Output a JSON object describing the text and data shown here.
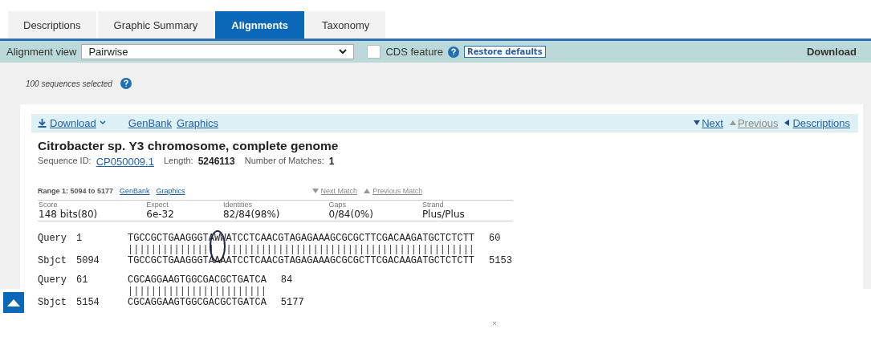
{
  "tabs": [
    {
      "label": "Descriptions",
      "selected": false
    },
    {
      "label": "Graphic Summary",
      "selected": false
    },
    {
      "label": "Alignments",
      "selected": true
    },
    {
      "label": "Taxonomy",
      "selected": false
    }
  ],
  "toolbar": {
    "view_label": "Alignment view",
    "view_value": "Pairwise",
    "cds_label": "CDS feature",
    "cds_checked": false,
    "restore_button": "Restore defaults",
    "download": "Download"
  },
  "selection_note": "100 sequences selected",
  "result": {
    "header_links": [
      {
        "label": "Download",
        "kind": "download"
      },
      {
        "label": "GenBank",
        "kind": "link"
      },
      {
        "label": "Graphics",
        "kind": "link"
      }
    ],
    "nav": [
      {
        "label": "Next",
        "kind": "down",
        "disabled": false
      },
      {
        "label": "Previous",
        "kind": "up",
        "disabled": true
      },
      {
        "label": "Descriptions",
        "kind": "left",
        "disabled": false
      }
    ],
    "title": "Citrobacter sp. Y3 chromosome, complete genome",
    "sequence_id_label": "Sequence ID:",
    "sequence_id": "CP050009.1",
    "length_label": "Length:",
    "length": "5246113",
    "matches_label": "Number of Matches:",
    "matches": "1",
    "range": {
      "label": "Range 1: 5094 to 5177",
      "links": [
        "GenBank",
        "Graphics"
      ],
      "match_nav": [
        {
          "label": "Next Match",
          "kind": "down",
          "disabled": true
        },
        {
          "label": "Previous Match",
          "kind": "up",
          "disabled": true
        }
      ]
    },
    "stats": {
      "columns": [
        "Score",
        "Expect",
        "Identities",
        "Gaps",
        "Strand"
      ],
      "values": [
        "148 bits(80)",
        "6e-32",
        "82/84(98%)",
        "0/84(0%)",
        "Plus/Plus"
      ]
    },
    "alignment": [
      {
        "annotated": true,
        "query_label": "Query",
        "query_start": "1",
        "query_seq": "TGCCGCTGAAGGGTAWWATCCTCAACGTAGAGAAAGCGCGCTTCGACAAGATGCTCTCTT",
        "query_end": "60",
        "match": "|||||||||||||||  |||||||||||||||||||||||||||||||||||||||||||",
        "sbjct_label": "Sbjct",
        "sbjct_start": "5094",
        "sbjct_seq": "TGCCGCTGAAGGGTAAAATCCTCAACGTAGAGAAAGCGCGCTTCGACAAGATGCTCTCTT",
        "sbjct_end": "5153"
      },
      {
        "annotated": false,
        "query_label": "Query",
        "query_start": "61",
        "query_seq": "CGCAGGAAGTGGCGACGCTGATCA",
        "query_end": "84",
        "match": "||||||||||||||||||||||||",
        "sbjct_label": "Sbjct",
        "sbjct_start": "5154",
        "sbjct_seq": "CGCAGGAAGTGGCGACGCTGATCA",
        "sbjct_end": "5177"
      }
    ]
  }
}
